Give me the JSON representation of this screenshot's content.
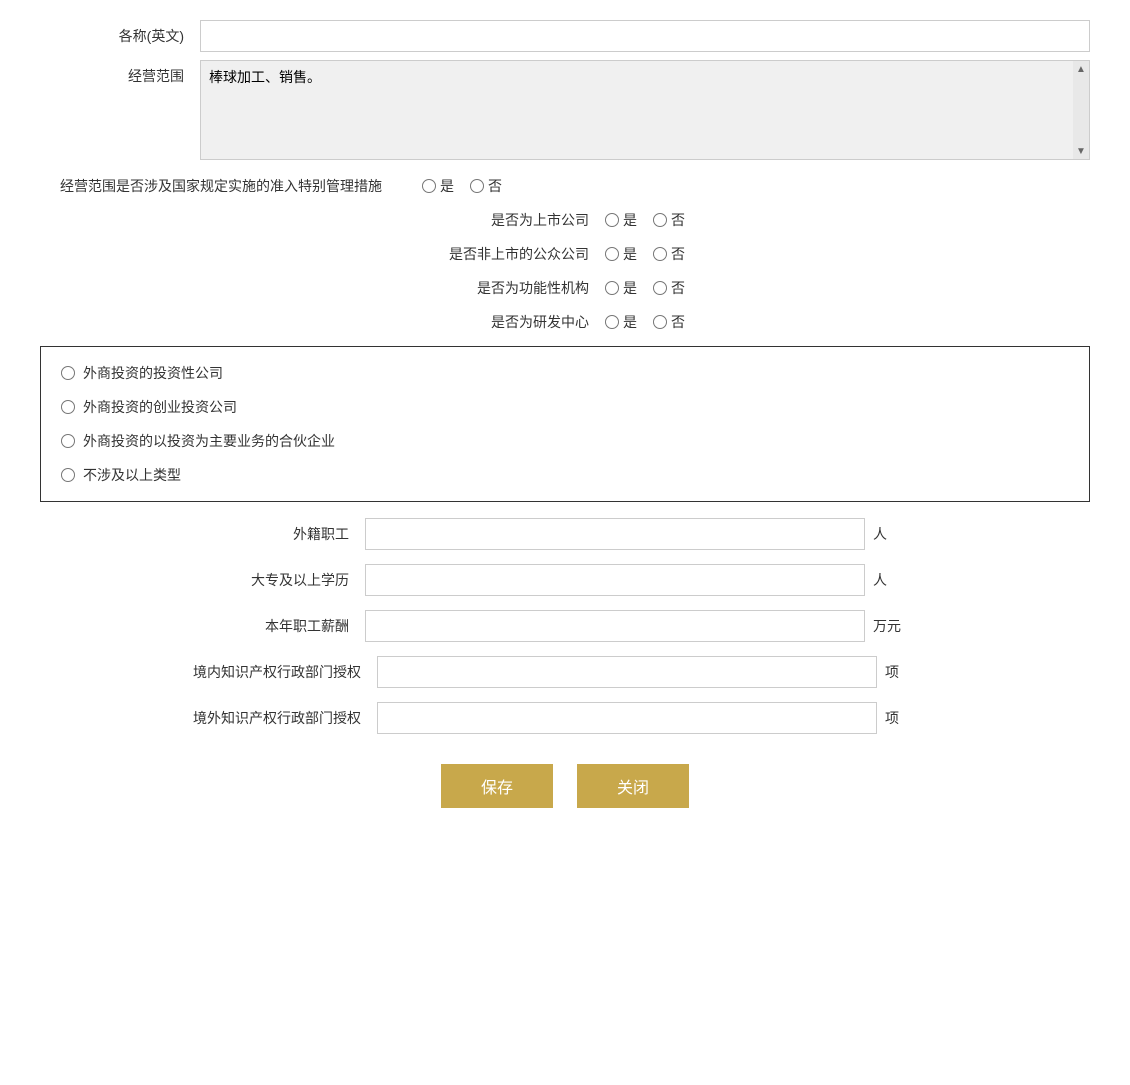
{
  "form": {
    "fields": {
      "english_name_label": "各称(英文)",
      "business_scope_label": "经营范围",
      "business_scope_value": "棒球加工、销售。",
      "special_management_label": "经营范围是否涉及国家规定实施的准入特别管理措施",
      "listed_company_label": "是否为上市公司",
      "non_listed_public_label": "是否非上市的公众公司",
      "functional_institution_label": "是否为功能性机构",
      "rd_center_label": "是否为研发中心",
      "foreign_employees_label": "外籍职工",
      "foreign_employees_unit": "人",
      "college_degree_label": "大专及以上学历",
      "college_degree_unit": "人",
      "annual_salary_label": "本年职工薪酬",
      "annual_salary_unit": "万元",
      "domestic_ip_label": "境内知识产权行政部门授权",
      "domestic_ip_unit": "项",
      "foreign_ip_label": "境外知识产权行政部门授权",
      "foreign_ip_unit": "项"
    },
    "radio_options": {
      "yes": "是",
      "no": "否"
    },
    "investment_types": [
      "外商投资的投资性公司",
      "外商投资的创业投资公司",
      "外商投资的以投资为主要业务的合伙企业",
      "不涉及以上类型"
    ],
    "buttons": {
      "save": "保存",
      "close": "关闭"
    }
  }
}
